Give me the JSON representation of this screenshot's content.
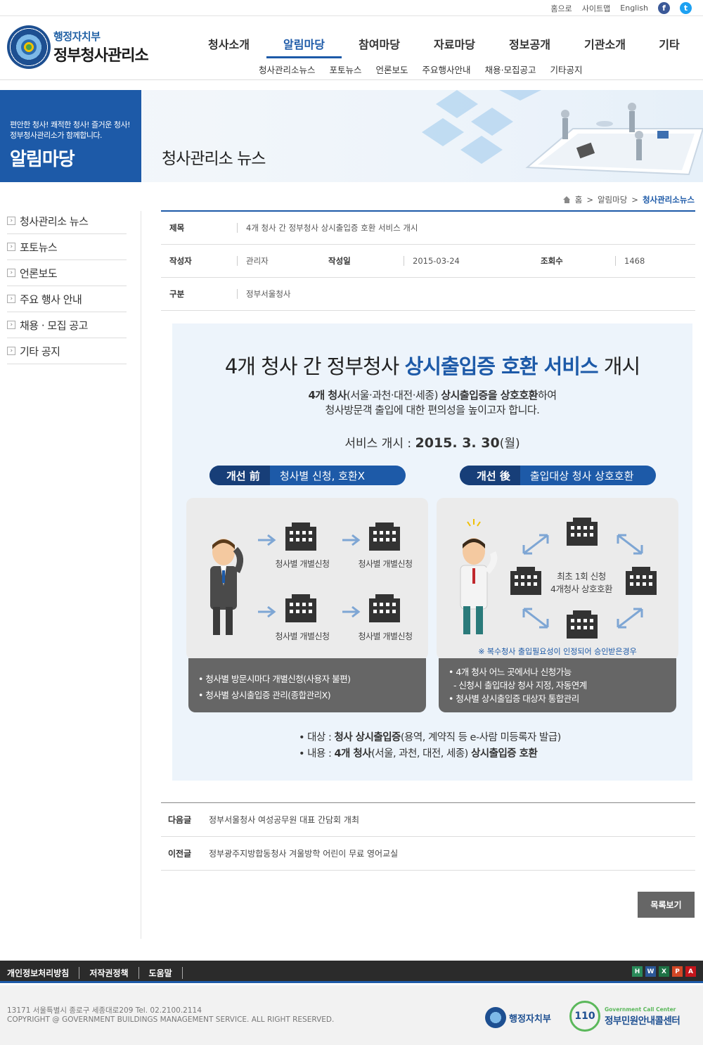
{
  "util": {
    "home": "홈으로",
    "sitemap": "사이트맵",
    "english": "English",
    "facebook_icon": "f",
    "twitter_icon": "t"
  },
  "logo": {
    "sub": "행정자치부",
    "main": "정부청사관리소"
  },
  "gnb": [
    "청사소개",
    "알림마당",
    "참여마당",
    "자료마당",
    "정보공개",
    "기관소개",
    "기타"
  ],
  "gnb_active": "알림마당",
  "sub_gnb": [
    "청사관리소뉴스",
    "포토뉴스",
    "언론보도",
    "주요행사안내",
    "채용·모집공고",
    "기타공지"
  ],
  "visual": {
    "slogan_line1": "편안한 청사! 쾌적한 청사! 즐거운 청사!",
    "slogan_line2": "정부청사관리소가 함께합니다.",
    "section": "알림마당",
    "page_title": "청사관리소 뉴스"
  },
  "breadcrumb": {
    "home": "홈",
    "sep": ">",
    "level1": "알림마당",
    "current": "청사관리소뉴스"
  },
  "lnb": [
    "청사관리소 뉴스",
    "포토뉴스",
    "언론보도",
    "주요 행사 안내",
    "채용 · 모집 공고",
    "기타 공지"
  ],
  "post": {
    "title_label": "제목",
    "title": "4개 청사 간 정부청사 상시출입증 호환 서비스 개시",
    "author_label": "작성자",
    "author": "관리자",
    "date_label": "작성일",
    "date": "2015-03-24",
    "views_label": "조회수",
    "views": "1468",
    "category_label": "구분",
    "category": "정부서울청사"
  },
  "infographic": {
    "headline_pre": "4개 청사 간 정부청사 ",
    "headline_em": "상시출입증 호환 서비스",
    "headline_post": " 개시",
    "desc_b1": "4개 청사",
    "desc_t1": "(서울·과천·대전·세종) ",
    "desc_b2": "상시출입증을 상호호환",
    "desc_t2": "하여",
    "desc_line2": "청사방문객 출입에 대한 편의성을 높이고자 합니다.",
    "service_label": "서비스 개시 : ",
    "service_date": "2015. 3. 30",
    "service_day": "(월)",
    "before_tag": "개선 前",
    "before_title": "청사별 신청, 호환X",
    "after_tag": "개선 後",
    "after_title": "출입대상 청사 상호호환",
    "building_label": "청사별 개별신청",
    "center_line1": "최초 1회 신청",
    "center_line2": "4개청사 상호호환",
    "note": "※ 복수청사 출입필요성이 인정되어 승인받은경우",
    "before_points": [
      "• 청사별 방문시마다 개별신청(사용자 불편)",
      "• 청사별 상시출입증 관리(종합관리X)"
    ],
    "after_points": [
      "• 4개 청사 어느 곳에서나 신청가능",
      "  - 신청시 출입대상 청사 지정, 자동연계",
      "• 청사별 상시출입증 대상자 통합관리"
    ],
    "target_label": "• 대상 : ",
    "target_b": "청사 상시출입증",
    "target_t": "(용역, 계약직 등 e-사람 미등록자 발급)",
    "content_label": "• 내용 : ",
    "content_b1": "4개 청사",
    "content_t": "(서울, 과천, 대전, 세종) ",
    "content_b2": "상시출입증 호환"
  },
  "nav_posts": {
    "next_label": "다음글",
    "next_title": "정부서울청사 여성공무원 대표 간담회 개최",
    "prev_label": "이전글",
    "prev_title": "정부광주지방합동청사 겨울방학 어린이 무료 영어교실"
  },
  "list_button": "목록보기",
  "footer": {
    "links": [
      "개인정보처리방침",
      "저작권정책",
      "도움말"
    ],
    "address": "13171 서울특별시 종로구 세종대로209 Tel. 02.2100.2114",
    "copyright": "COPYRIGHT @ GOVERNMENT BUILDINGS MANAGEMENT SERVICE. ALL RIGHT RESERVED.",
    "mois": "행정자치부",
    "call_en": "Government Call Center",
    "call_num": "110",
    "call_ko": "정부민원안내콜센터",
    "doc_icons": [
      "H",
      "W",
      "X",
      "P",
      "A"
    ]
  },
  "colors": {
    "brand": "#1d5aa8",
    "dark_brand": "#173e78",
    "footer": "#2b2b2b"
  }
}
